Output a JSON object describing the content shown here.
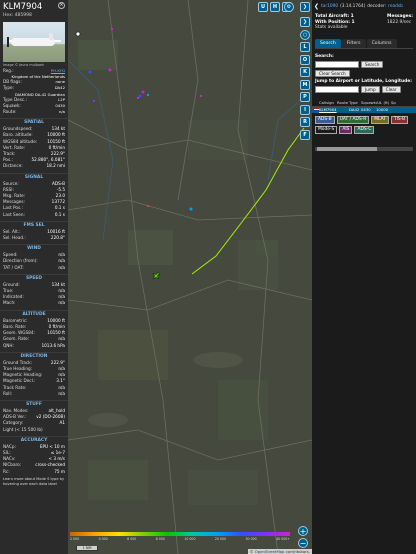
{
  "info": {
    "callsign": "KLM7904",
    "hex_label": "Hex: 485998",
    "close_glyph": "×",
    "photo_credit": "Image © Jeuns mulboek",
    "top_rows": [
      {
        "k": "Reg.:",
        "v": "PH-KFD",
        "link": true
      },
      {
        "k": "",
        "v": "Kingdom of the Netherlands"
      },
      {
        "k": "DB flags:",
        "v": "none"
      },
      {
        "k": "Type:",
        "v": "DA42"
      },
      {
        "k": "",
        "v": "DIAMOND DA-42 Guardian"
      },
      {
        "k": "Type Desc.:",
        "v": "L2P"
      },
      {
        "k": "Squawk:",
        "v": "0430"
      },
      {
        "k": "Route:",
        "v": "n/a"
      }
    ],
    "sections": [
      {
        "title": "SPATIAL",
        "rows": [
          {
            "k": "Groundspeed:",
            "v": "134 kt"
          },
          {
            "k": "Baro. altitude:",
            "v": "10000 ft"
          },
          {
            "k": "WGS84 altitude:",
            "v": "10150 ft"
          },
          {
            "k": "Vert. Rate:",
            "v": "0 ft/min"
          },
          {
            "k": "Track:",
            "v": "222.9°"
          },
          {
            "k": "Pos.:",
            "v": "52.880°, 6.081°"
          },
          {
            "k": "Distance:",
            "v": "18.2 nmi"
          }
        ]
      },
      {
        "title": "SIGNAL",
        "rows": [
          {
            "k": "Source:",
            "v": "ADS-B"
          },
          {
            "k": "RSSI:",
            "v": "-5.5"
          },
          {
            "k": "Msg. Rate:",
            "v": "23.0"
          },
          {
            "k": "Messages:",
            "v": "13772"
          },
          {
            "k": "Last Pos.:",
            "v": "0.1 s"
          },
          {
            "k": "Last Seen:",
            "v": "0.1 s"
          }
        ]
      },
      {
        "title": "FMS SEL",
        "rows": [
          {
            "k": "Sel. Alt.:",
            "v": "10016 ft"
          },
          {
            "k": "Sel. Head.:",
            "v": "220.8°"
          }
        ]
      },
      {
        "title": "WIND",
        "rows": [
          {
            "k": "Speed:",
            "v": "n/a"
          },
          {
            "k": "Direction (from):",
            "v": "n/a"
          },
          {
            "k": "TAT / OAT:",
            "v": "n/a"
          }
        ]
      },
      {
        "title": "SPEED",
        "rows": [
          {
            "k": "Ground:",
            "v": "134 kt"
          },
          {
            "k": "True:",
            "v": "n/a"
          },
          {
            "k": "Indicated:",
            "v": "n/a"
          },
          {
            "k": "Mach:",
            "v": "n/a"
          }
        ]
      },
      {
        "title": "ALTITUDE",
        "rows": [
          {
            "k": "Barometric:",
            "v": "10000 ft"
          },
          {
            "k": "Baro. Rate:",
            "v": "0 ft/min"
          },
          {
            "k": "Geom. WGS84:",
            "v": "10150 ft"
          },
          {
            "k": "Geom. Rate:",
            "v": "n/a"
          },
          {
            "k": "QNH:",
            "v": "1013.6 hPa"
          }
        ]
      },
      {
        "title": "DIRECTION",
        "rows": [
          {
            "k": "Ground Track:",
            "v": "222.9°"
          },
          {
            "k": "True Heading:",
            "v": "n/a"
          },
          {
            "k": "Magnetic Heading:",
            "v": "n/a"
          },
          {
            "k": "Magnetic Decl.:",
            "v": "3.1°"
          },
          {
            "k": "Track Rate:",
            "v": "n/a"
          },
          {
            "k": "Roll:",
            "v": "n/a"
          }
        ]
      },
      {
        "title": "STUFF",
        "rows": [
          {
            "k": "Nav. Modes:",
            "v": "alt_hold"
          },
          {
            "k": "ADS-B Ver.:",
            "v": "v2 (DO-260B)"
          },
          {
            "k": "Category:",
            "v": "A1"
          },
          {
            "k": "Light (< 15 500 lb)",
            "v": ""
          }
        ]
      },
      {
        "title": "ACCURACY",
        "rows": [
          {
            "k": "NACp:",
            "v": "EPU < 10 m"
          },
          {
            "k": "SIL:",
            "v": "≤ 1e-7"
          },
          {
            "k": "NACv:",
            "v": "< 3 m/s"
          },
          {
            "k": "NICbaro:",
            "v": "cross-checked"
          },
          {
            "k": "Rc:",
            "v": "75 m"
          }
        ]
      }
    ],
    "learn_more": "Learn more about Mode S type by hovering over each data label"
  },
  "map": {
    "buttons_top": [
      {
        "id": "u",
        "label": "U"
      },
      {
        "id": "h",
        "label": "H"
      },
      {
        "id": "t",
        "label": "T"
      }
    ],
    "buttons_side": [
      {
        "id": "l",
        "label": "L"
      },
      {
        "id": "o",
        "label": "O"
      },
      {
        "id": "k",
        "label": "K"
      },
      {
        "id": "m",
        "label": "M"
      },
      {
        "id": "p",
        "label": "P"
      },
      {
        "id": "i",
        "label": "I"
      },
      {
        "id": "r",
        "label": "R"
      },
      {
        "id": "f",
        "label": "F"
      }
    ],
    "zoom_in": "+",
    "zoom_out": "−",
    "scale_label": "1 NM",
    "altitude_ticks": [
      "2 000",
      "4 000",
      "6 000",
      "8 000",
      "10 000",
      "20 000",
      "30 000",
      "40 000+"
    ],
    "attribution_prefix": "© ",
    "attribution_link": "OpenStreetMap",
    "attribution_suffix": " contributors."
  },
  "right": {
    "app_link": "tar1090",
    "version": "(3.14.1764)",
    "decoder_label": "decoder:",
    "decoder_link": "readsb",
    "stats": {
      "total_label": "Total Aircraft:",
      "total_value": "1",
      "with_pos_label": "With Position:",
      "with_pos_value": "1",
      "stats_label": "Stats available",
      "messages_label": "Messages:",
      "messages_value": "1822.9/sec"
    },
    "tabs": [
      "Search",
      "Filters",
      "Columns"
    ],
    "search_label": "Search:",
    "search_button": "Search",
    "clear_search": "Clear Search",
    "jump_label": "Jump to Airport or Latitude, Longitude:",
    "jump_button": "Jump",
    "clear_button": "Clear",
    "columns": [
      "",
      "Callsign",
      "Route",
      "Type",
      "Squawk",
      "Alt. (ft)",
      "Sp"
    ],
    "row": [
      "",
      "KLM7904",
      "",
      "DA42",
      "0430",
      "10000",
      ""
    ],
    "badges": [
      {
        "label": "ADS-B",
        "color": "#3a5a9a"
      },
      {
        "label": "UAT / ADS-R",
        "color": "#2e6b2e"
      },
      {
        "label": "MLAT",
        "color": "#7a6a20"
      },
      {
        "label": "TIS-B",
        "color": "#8a2e2e"
      },
      {
        "label": "Mode-S",
        "color": "#1b1b1b"
      },
      {
        "label": "AIS",
        "color": "#6a2a6a"
      },
      {
        "label": "ADS-C",
        "color": "#2a6a5a"
      }
    ]
  },
  "colors": {
    "accent": "#005f8d",
    "section": "#7ab6e8",
    "link": "#5eb3ff",
    "track": "#a6f000",
    "aircraft": "#54d400"
  }
}
